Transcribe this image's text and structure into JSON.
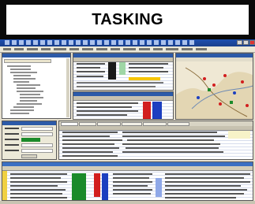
{
  "header": {
    "title": "TASKING"
  },
  "screenshot": {
    "description_icon": "application-window-icon",
    "accent_colors": {
      "title_bar": "#1d4fb0",
      "panel_title": "#2c5aa8",
      "highlight_green": "#1a8a2a",
      "highlight_red": "#d21e1e",
      "highlight_blue": "#1c3fc0",
      "window_bg": "#e6e0cf"
    }
  }
}
